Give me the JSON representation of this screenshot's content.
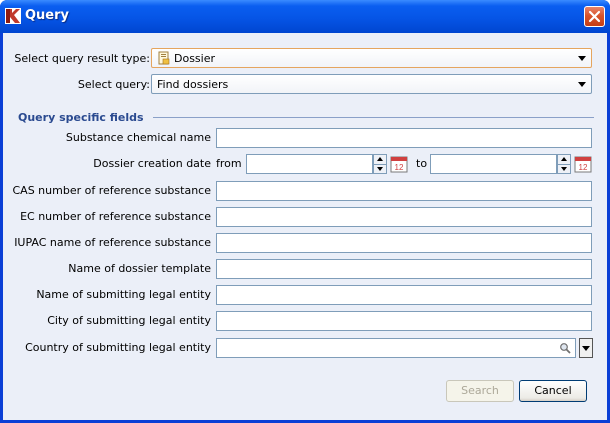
{
  "window": {
    "title": "Query",
    "icon": "app-logo-icon",
    "close_icon": "close-icon"
  },
  "form": {
    "result_type_label": "Select query result type:",
    "result_type_value": "Dossier",
    "result_type_icon": "dossier-icon",
    "query_label": "Select query:",
    "query_value": "Find dossiers"
  },
  "section": {
    "title": "Query specific fields"
  },
  "fields": {
    "substance_name_label": "Substance chemical name",
    "creation_date_label": "Dossier creation date",
    "from_label": "from",
    "to_label": "to",
    "cas_label": "CAS number of reference substance",
    "ec_label": "EC number of reference substance",
    "iupac_label": "IUPAC name of reference substance",
    "template_label": "Name of dossier template",
    "legal_entity_label": "Name of submitting legal entity",
    "city_label": "City of submitting legal entity",
    "country_label": "Country of submitting legal entity"
  },
  "buttons": {
    "search_label": "Search",
    "search_enabled": false,
    "cancel_label": "Cancel"
  },
  "colors": {
    "title_bar": "#0655e6",
    "client_bg": "#ebeff8",
    "section_title": "#2a4a90",
    "close_button": "#d8542c"
  }
}
